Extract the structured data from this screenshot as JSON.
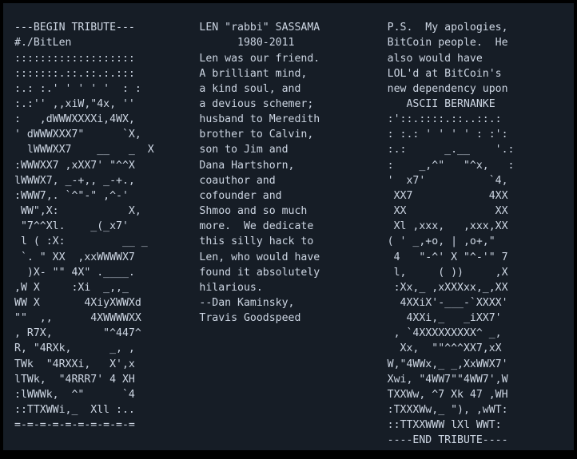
{
  "window": {
    "background_color": "#161d26",
    "border_color": "#000000",
    "text_color": "#cdd6e3"
  },
  "columns": {
    "left": {
      "name": "ascii-art-bitlen-column",
      "text": "---BEGIN TRIBUTE---\n#./BitLen\n:::::::::::::::::::\n:::::::.::.::.:.:::\n:.: :.' ' ' ' '  : :\n:.:'' ,,xiW,\"4x, ''\n:   ,dWWWXXXXi,4WX,\n' dWWWXXX7\"      `X,\n  lWWWXX7    __   _  X\n:WWWXX7 ,xXX7' \"^^X\nlWWWX7, _-+,, _-+.,\n:WWW7,. `^\"-\" ,^-'\n WW\",X:           X,\n \"7^^Xl.    _(_x7'\n l ( :X:         __ _\n `. \" XX  ,xxWWWWX7\n  )X- \"\" 4X\" .____.\n,W X     :Xi  _,,_\nWW X       4XiyXWWXd\n\"\"  ,,      4XWWWWXX\n, R7X,        \"^447^\nR, \"4RXk,      _, ,\nTWk  \"4RXXi,   X',x\nlTWk,  \"4RRR7' 4 XH\n:lWWWk,  ^\"      `4\n::TTXWWi,_  Xll :..\n=-=-=-=-=-=-=-=-=-="
    },
    "middle": {
      "name": "tribute-text-column",
      "text": "LEN \"rabbi\" SASSAMA\n      1980-2011\nLen was our friend.\nA brilliant mind,\na kind soul, and\na devious schemer;\nhusband to Meredith\nbrother to Calvin,\nson to Jim and\nDana Hartshorn,\ncoauthor and\ncofounder and\nShmoo and so much\nmore.  We dedicate\nthis silly hack to\nLen, who would have\nfound it absolutely\nhilarious.\n--Dan Kaminsky,\nTravis Goodspeed"
    },
    "right": {
      "name": "ascii-bernanke-column",
      "text": "P.S.  My apologies,\nBitCoin people.  He\nalso would have\nLOL'd at BitCoin's\nnew dependency upon\n   ASCII BERNANKE\n:'::.::::.::..::.:\n: :.: ' ' ' ' : :':\n:.:      _.__    '.:\n:    _,^\"   \"^x,   :\n'  x7'          `4,\n XX7            4XX\n XX              XX\n Xl ,xxx,   ,xxx,XX\n( ' _,+o, | ,o+,\"\n 4   \"-^' X \"^-'\" 7\n l,     ( ))     ,X\n :Xx,_ ,xXXXxx,_,XX\n  4XXiX'-___-`XXXX'\n   4XXi,_   _iXX7'\n , `4XXXXXXXXX^ _,\n  Xx,  \"\"^^^XX7,xX\nW,\"4WWx,_ _,XxWWX7'\nXwi, \"4WW7\"\"4WW7',W\nTXXWw, ^7 Xk 47 ,WH\n:TXXXWw,_ \"), ,wWT:\n::TTXXWWW lXl WWT:\n----END TRIBUTE----"
    }
  }
}
